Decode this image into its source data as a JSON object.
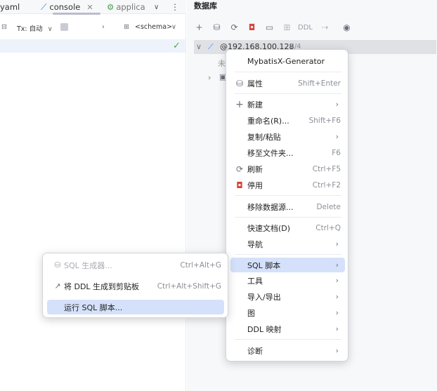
{
  "editor": {
    "tabs": [
      {
        "label": "yaml"
      },
      {
        "label": "console",
        "close": "✕"
      },
      {
        "label": "applica"
      }
    ],
    "toolbar": {
      "tx_label": "Tx: 自动",
      "schema_label": "<schema>"
    }
  },
  "db_panel": {
    "title": "数据库",
    "toolbar": {
      "ddl_label": "DDL"
    },
    "tree": {
      "host_label": "@192.168.100.128",
      "host_count": "2/4",
      "child_label": "未"
    }
  },
  "context_menu": {
    "items": [
      {
        "label": "MybatisX-Generator"
      },
      {
        "label": "属性",
        "shortcut": "Shift+Enter",
        "icon": "properties-icon"
      },
      {
        "label": "新建",
        "icon": "plus-icon",
        "submenu": true
      },
      {
        "label": "重命名(R)...",
        "shortcut": "Shift+F6"
      },
      {
        "label": "复制/粘贴",
        "submenu": true
      },
      {
        "label": "移至文件夹...",
        "shortcut": "F6"
      },
      {
        "label": "刷新",
        "shortcut": "Ctrl+F5",
        "icon": "refresh-icon"
      },
      {
        "label": "停用",
        "shortcut": "Ctrl+F2",
        "icon": "deactivate-icon"
      },
      {
        "label": "移除数据源...",
        "shortcut": "Delete"
      },
      {
        "label": "快速文档(D)",
        "shortcut": "Ctrl+Q"
      },
      {
        "label": "导航",
        "submenu": true
      },
      {
        "label": "SQL 脚本",
        "submenu": true,
        "highlighted": true
      },
      {
        "label": "工具",
        "submenu": true
      },
      {
        "label": "导入/导出",
        "submenu": true
      },
      {
        "label": "图",
        "submenu": true
      },
      {
        "label": "DDL 映射",
        "submenu": true
      },
      {
        "label": "诊断",
        "submenu": true
      }
    ]
  },
  "sql_submenu": {
    "items": [
      {
        "label": "SQL 生成器...",
        "shortcut": "Ctrl+Alt+G",
        "disabled": true,
        "icon": "sql-generator-icon"
      },
      {
        "label": "将 DDL 生成到剪贴板",
        "shortcut": "Ctrl+Alt+Shift+G",
        "icon": "export-icon"
      },
      {
        "label": "运行 SQL 脚本...",
        "highlighted": true
      }
    ]
  },
  "colors": {
    "highlight": "#d5e1fb",
    "accent": "#3574f0",
    "success": "#4fa64f",
    "danger": "#d6443b"
  }
}
